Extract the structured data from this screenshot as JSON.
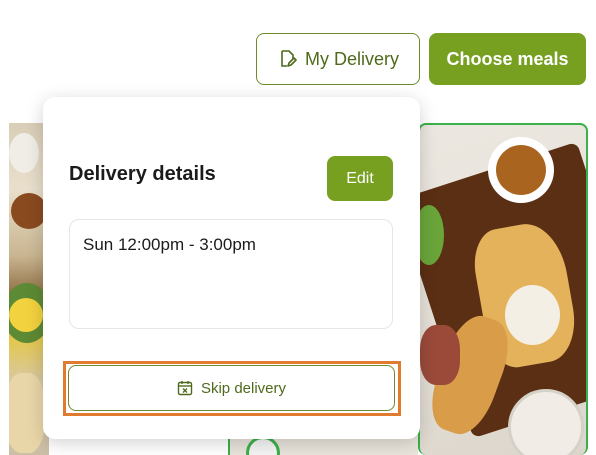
{
  "header": {
    "my_delivery_label": "My Delivery",
    "my_delivery_icon": "edit-note-icon",
    "choose_meals_label": "Choose meals"
  },
  "popup": {
    "title": "Delivery details",
    "edit_label": "Edit",
    "delivery_time": "Sun 12:00pm - 3:00pm",
    "skip_label": "Skip delivery",
    "skip_icon": "calendar-x-icon"
  },
  "colors": {
    "brand_green": "#77a021",
    "outline_green": "#6e8a2e",
    "highlight_orange": "#e07b2f",
    "tile_border_green": "#3ab14a"
  }
}
